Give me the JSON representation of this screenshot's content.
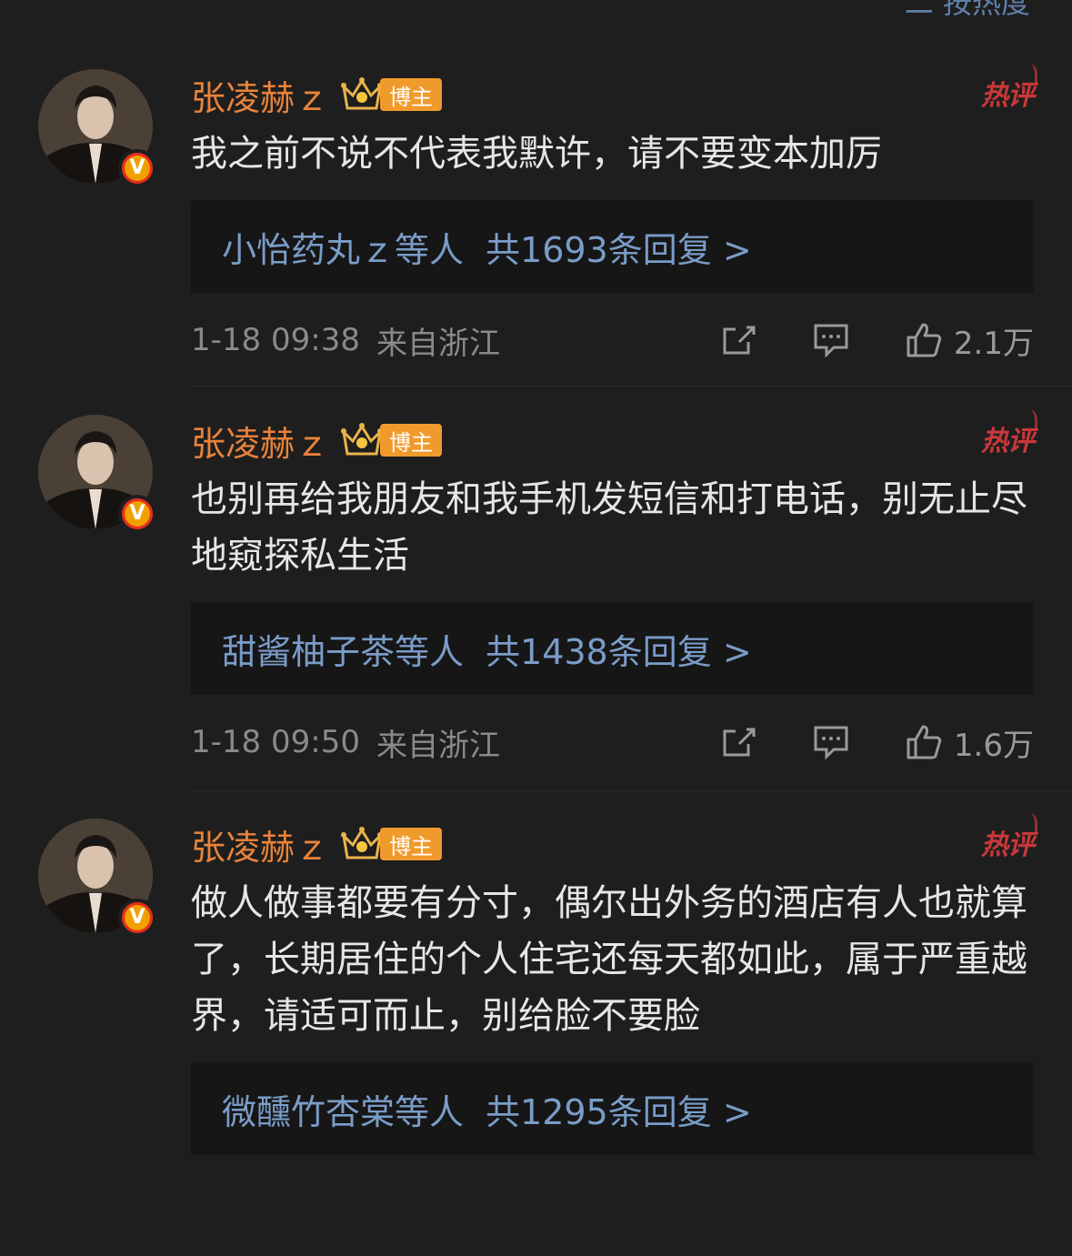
{
  "header": {
    "sort_label": "二 按热度"
  },
  "comments": [
    {
      "username": "张凌赫ｚ",
      "blogger_label": "博主",
      "hot_label": "热评",
      "verified_label": "V",
      "text": "我之前不说不代表我默许，请不要变本加厉",
      "replies": {
        "who": "小怡药丸ｚ",
        "suffix": "等人",
        "count_text": "共1693条回复 >"
      },
      "time": "1-18 09:38",
      "location": "来自浙江",
      "likes": "2.1万"
    },
    {
      "username": "张凌赫ｚ",
      "blogger_label": "博主",
      "hot_label": "热评",
      "verified_label": "V",
      "text": "也别再给我朋友和我手机发短信和打电话，别无止尽地窥探私生活",
      "replies": {
        "who": "甜酱柚子茶",
        "suffix": "等人",
        "count_text": "共1438条回复 >"
      },
      "time": "1-18 09:50",
      "location": "来自浙江",
      "likes": "1.6万"
    },
    {
      "username": "张凌赫ｚ",
      "blogger_label": "博主",
      "hot_label": "热评",
      "verified_label": "V",
      "text": "做人做事都要有分寸，偶尔出外务的酒店有人也就算了，长期居住的个人住宅还每天都如此，属于严重越界，请适可而止，别给脸不要脸",
      "replies": {
        "who": "微醺竹杏棠",
        "suffix": "等人",
        "count_text": "共1295条回复 >"
      }
    }
  ],
  "colors": {
    "background": "#1e1e1e",
    "username": "#e8833a",
    "link": "#7a9cc8",
    "hot": "#c8383a",
    "blogger_badge": "#f19a2c"
  },
  "icons": [
    "share-icon",
    "comment-icon",
    "like-icon",
    "crown-icon",
    "verified-icon"
  ]
}
